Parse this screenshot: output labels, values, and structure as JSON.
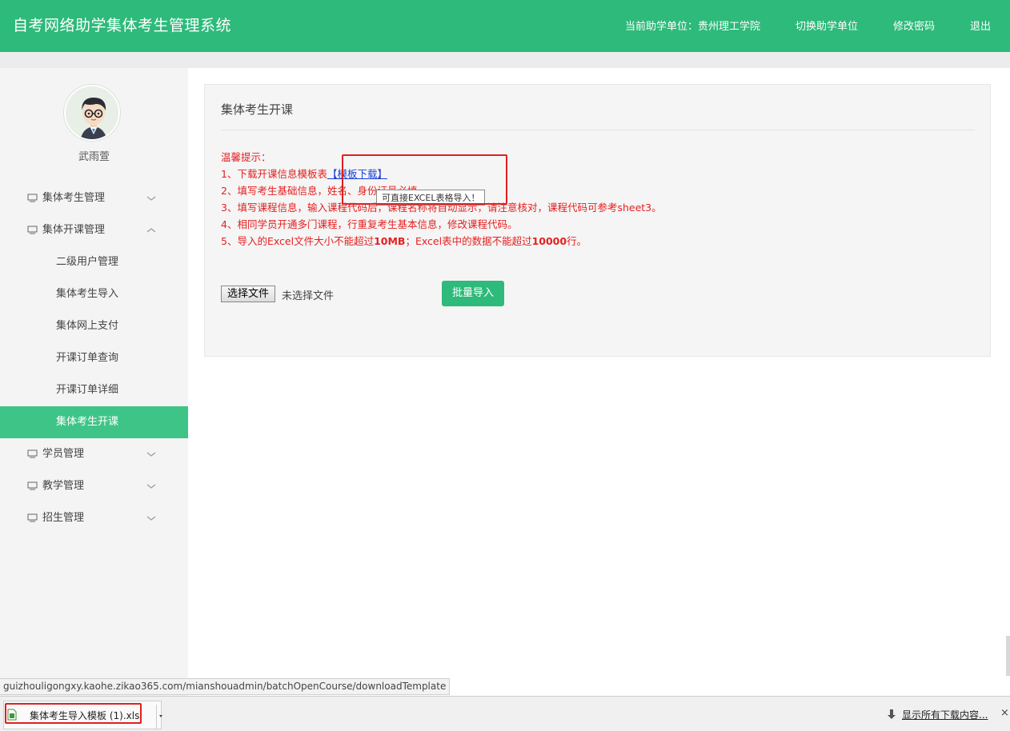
{
  "header": {
    "title": "自考网络助学集体考生管理系统",
    "current_unit": "当前助学单位：贵州理工学院",
    "switch_unit": "切换助学单位",
    "change_password": "修改密码",
    "logout": "退出"
  },
  "sidebar": {
    "username": "武雨萱",
    "menu": [
      {
        "label": "集体考生管理",
        "expanded": false
      },
      {
        "label": "集体开课管理",
        "expanded": true,
        "children": [
          "二级用户管理",
          "集体考生导入",
          "集体网上支付",
          "开课订单查询",
          "开课订单详细",
          "集体考生开课"
        ],
        "active_child": "集体考生开课"
      },
      {
        "label": "学员管理",
        "expanded": false
      },
      {
        "label": "教学管理",
        "expanded": false
      },
      {
        "label": "招生管理",
        "expanded": false
      }
    ]
  },
  "main": {
    "title": "集体考生开课",
    "tips": {
      "heading": "温馨提示：",
      "line1_prefix": "1、下载开课信息模板表",
      "line1_link": "【模板下载】",
      "line2": "2、填写考生基础信息，姓名、身份证号必填。",
      "line3": "3、填写课程信息，输入课程代码后，课程名称将自动显示，请注意核对，课程代码可参考sheet3。",
      "line4": "4、相同学员开通多门课程，行重复考生基本信息，修改课程代码。",
      "line5_a": "5、导入的Excel文件大小不能超过",
      "line5_b": "10MB",
      "line5_c": "；Excel表中的数据不能超过",
      "line5_d": "10000",
      "line5_e": "行。"
    },
    "tooltip": "可直接EXCEL表格导入！",
    "choose_file": "选择文件",
    "file_status": "未选择文件",
    "import_button": "批量导入"
  },
  "status_url": "guizhouligongxy.kaohe.zikao365.com/mianshouadmin/batchOpenCourse/downloadTemplate",
  "download_bar": {
    "file_name": "集体考生导入模板 (1).xls",
    "show_all": "显示所有下载内容...",
    "close": "×"
  },
  "colors": {
    "brand": "#2dba7a",
    "active": "#3fc487",
    "tip": "#e52020",
    "highlight": "#e02020"
  }
}
